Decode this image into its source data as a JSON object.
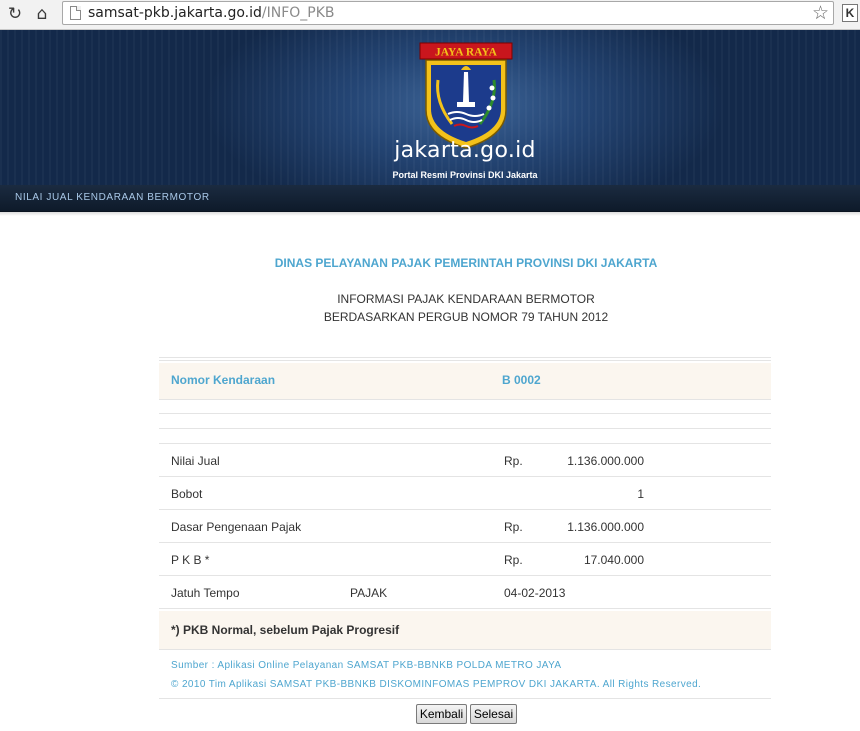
{
  "browser": {
    "url_host": "samsat-pkb.jakarta.go.id",
    "url_path": "/INFO_PKB",
    "ext_label": "K"
  },
  "header": {
    "emblem_text": "JAYA RAYA",
    "site_name": "jakarta.go.id",
    "tagline": "Portal Resmi Provinsi DKI Jakarta",
    "nav_label": "NILAI JUAL KENDARAAN BERMOTOR"
  },
  "titles": {
    "agency": "DINAS PELAYANAN PAJAK PEMERINTAH PROVINSI DKI JAKARTA",
    "line1": "INFORMASI PAJAK KENDARAAN BERMOTOR",
    "line2": "BERDASARKAN PERGUB NOMOR 79 TAHUN 2012"
  },
  "table": {
    "plate_label": "Nomor Kendaraan",
    "plate_value": "B 0002",
    "rows": [
      {
        "label": "Nilai Jual",
        "currency": "Rp.",
        "value": "1.136.000.000"
      },
      {
        "label": "Bobot",
        "currency": "",
        "value": "1"
      },
      {
        "label": "Dasar Pengenaan Pajak",
        "currency": "Rp.",
        "value": "1.136.000.000"
      },
      {
        "label": "P K B *",
        "currency": "Rp.",
        "value": "17.040.000"
      }
    ],
    "due": {
      "label": "Jatuh Tempo",
      "type": "PAJAK",
      "date": "04-02-2013"
    },
    "note": "*) PKB Normal, sebelum Pajak Progresif"
  },
  "footer": {
    "source": "Sumber : Aplikasi Online Pelayanan SAMSAT PKB-BBNKB POLDA METRO JAYA",
    "copyright": "© 2010 Tim Aplikasi SAMSAT PKB-BBNKB DISKOMINFOMAS PEMPROV DKI JAKARTA. All Rights Reserved."
  },
  "buttons": {
    "back": "Kembali",
    "done": "Selesai"
  },
  "colors": {
    "accent_blue": "#4ea6cf",
    "header_bg": "#13294a",
    "row_highlight": "#fbf6ef"
  }
}
